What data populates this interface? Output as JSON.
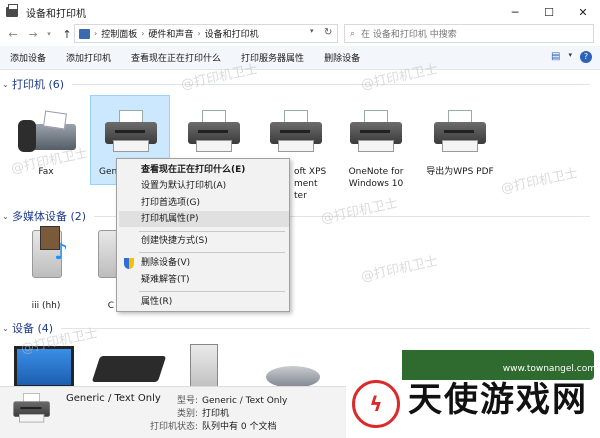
{
  "window": {
    "title": "设备和打印机",
    "min": "─",
    "max": "☐",
    "close": "✕"
  },
  "address": {
    "breadcrumbs": [
      "控制面板",
      "硬件和声音",
      "设备和打印机"
    ],
    "search_placeholder": "在 设备和打印机 中搜索"
  },
  "commands": [
    "添加设备",
    "添加打印机",
    "查看现在正在打印什么",
    "打印服务器属性",
    "删除设备"
  ],
  "groups": {
    "printers": {
      "label": "打印机 (6)"
    },
    "multimedia": {
      "label": "多媒体设备 (2)"
    },
    "devices": {
      "label": "设备 (4)"
    }
  },
  "printers": [
    {
      "caption": "Fax"
    },
    {
      "caption": "Gen"
    },
    {
      "caption": ""
    },
    {
      "caption": "oft XPS\nment\nter"
    },
    {
      "caption": "OneNote for\nWindows 10"
    },
    {
      "caption": "导出为WPS PDF"
    }
  ],
  "multimedia": [
    {
      "caption": "iii (hh)"
    },
    {
      "caption": "C"
    }
  ],
  "context_menu": {
    "items": [
      {
        "label": "查看现在正在打印什么(E)",
        "bold": true
      },
      {
        "label": "设置为默认打印机(A)"
      },
      {
        "label": "打印首选项(G)"
      },
      {
        "label": "打印机属性(P)"
      },
      {
        "label": "创建快捷方式(S)"
      },
      {
        "label": "删除设备(V)"
      },
      {
        "label": "疑难解答(T)"
      },
      {
        "label": "属性(R)"
      }
    ]
  },
  "status": {
    "name": "Generic / Text Only",
    "model_key": "型号:",
    "model_val": "Generic / Text Only",
    "category_key": "类别:",
    "category_val": "打印机",
    "state_key": "打印机状态:",
    "state_val": "队列中有 0 个文档"
  },
  "watermark": "@打印机卫士",
  "logo": {
    "url": "www.townangel.com",
    "text": "天使游戏网"
  }
}
